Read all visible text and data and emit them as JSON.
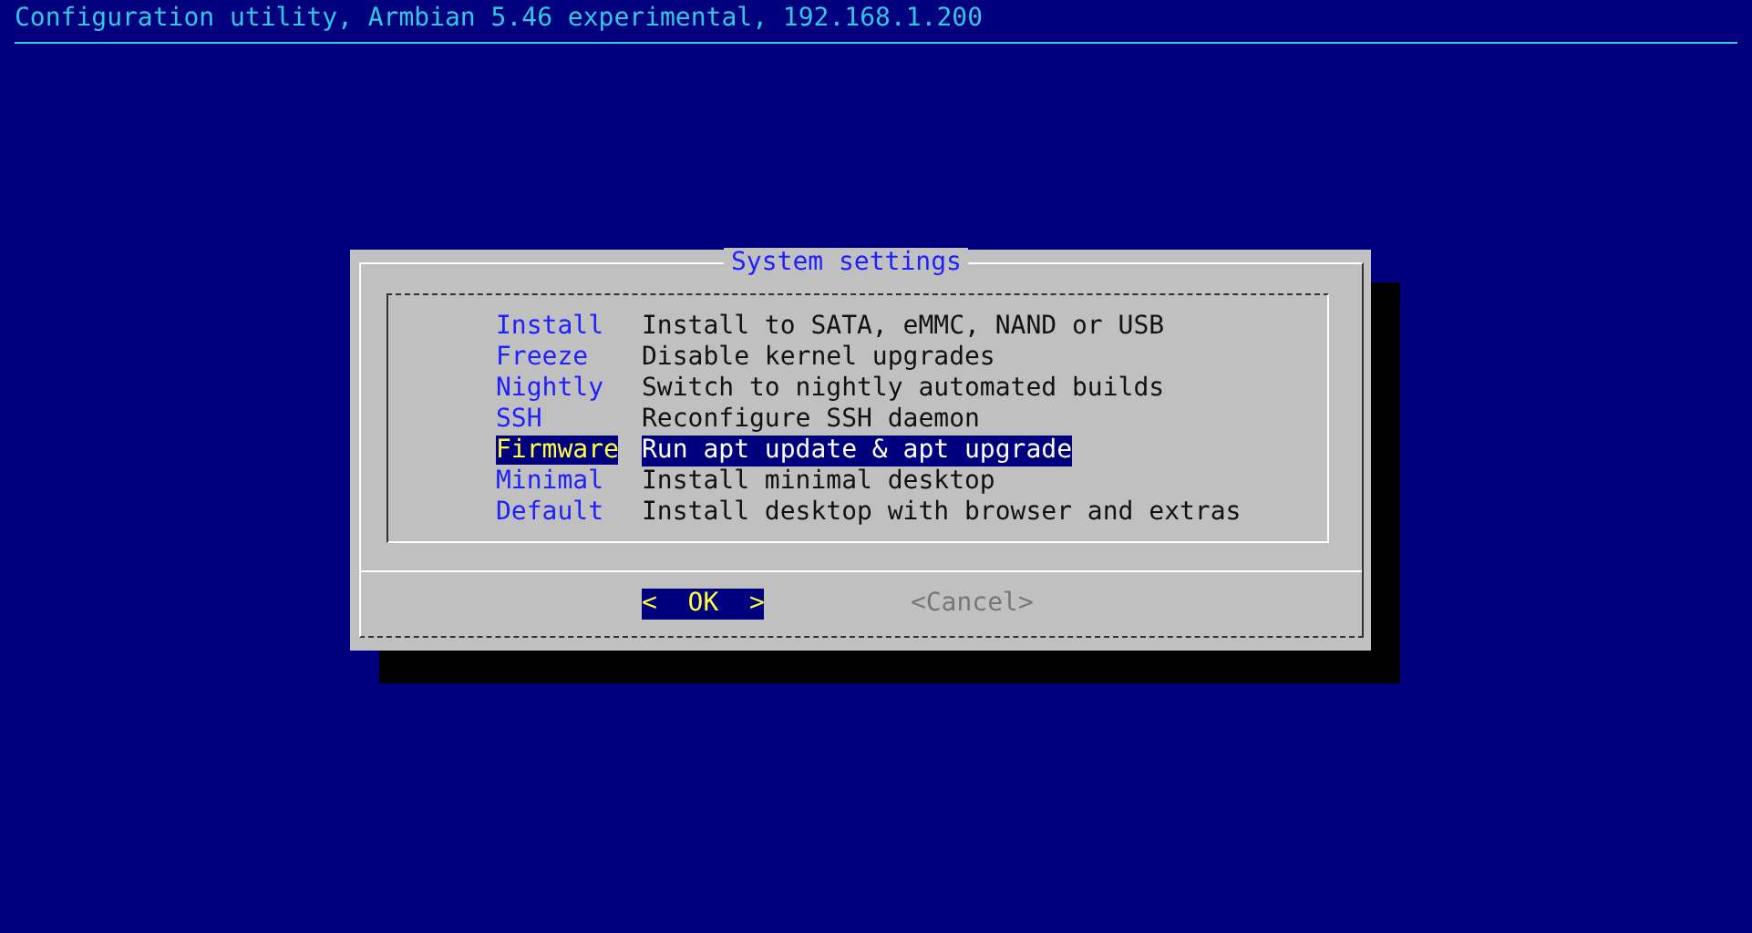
{
  "header": {
    "title": "Configuration utility, Armbian 5.46 experimental, 192.168.1.200"
  },
  "dialog": {
    "title": "System settings",
    "menu": {
      "items": [
        {
          "tag": "Install",
          "description": "Install to SATA, eMMC, NAND or USB",
          "selected": false
        },
        {
          "tag": "Freeze",
          "description": "Disable kernel upgrades",
          "selected": false
        },
        {
          "tag": "Nightly",
          "description": "Switch to nightly automated builds",
          "selected": false
        },
        {
          "tag": "SSH",
          "description": "Reconfigure SSH daemon",
          "selected": false
        },
        {
          "tag": "Firmware",
          "description": "Run apt update & apt upgrade",
          "selected": true
        },
        {
          "tag": "Minimal",
          "description": "Install minimal desktop",
          "selected": false
        },
        {
          "tag": "Default",
          "description": "Install desktop with browser and extras",
          "selected": false
        }
      ]
    },
    "buttons": [
      {
        "label": "<  OK  >",
        "selected": true
      },
      {
        "label": "<Cancel>",
        "selected": false
      }
    ]
  }
}
